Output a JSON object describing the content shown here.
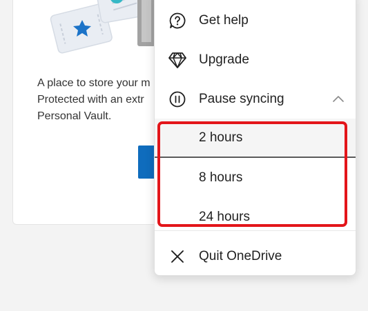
{
  "vault": {
    "description_lines": [
      "A place to store your m",
      "Protected with an extr",
      "Personal Vault."
    ]
  },
  "menu": {
    "items": [
      {
        "label": "Get help",
        "icon": "help-circle-icon"
      },
      {
        "label": "Upgrade",
        "icon": "diamond-icon"
      },
      {
        "label": "Pause syncing",
        "icon": "pause-circle-icon",
        "expanded": true
      }
    ],
    "pause_options": [
      {
        "label": "2 hours",
        "selected": true
      },
      {
        "label": "8 hours"
      },
      {
        "label": "24 hours"
      }
    ],
    "quit": {
      "label": "Quit OneDrive",
      "icon": "close-icon"
    }
  },
  "colors": {
    "accent": "#0f6cbd",
    "highlight": "#e3151a",
    "star": "#1b73c8"
  }
}
